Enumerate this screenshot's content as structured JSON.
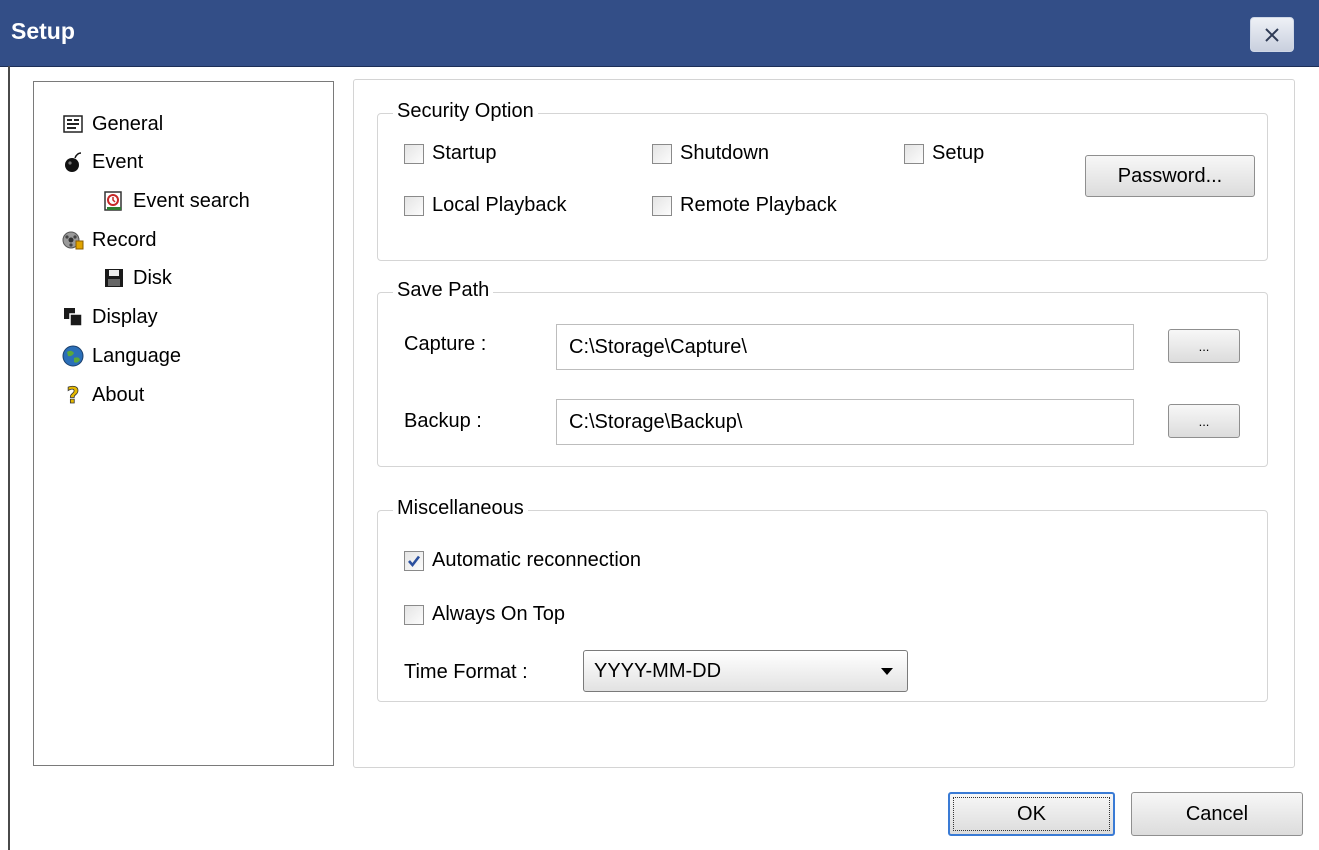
{
  "window": {
    "title": "Setup"
  },
  "nav": {
    "items": [
      {
        "label": "General",
        "icon": "general-icon"
      },
      {
        "label": "Event",
        "icon": "bomb-icon"
      },
      {
        "label": "Event search",
        "icon": "event-search-icon"
      },
      {
        "label": "Record",
        "icon": "record-icon"
      },
      {
        "label": "Disk",
        "icon": "floppy-disk-icon"
      },
      {
        "label": "Display",
        "icon": "display-icon"
      },
      {
        "label": "Language",
        "icon": "globe-icon"
      },
      {
        "label": "About",
        "icon": "question-mark-icon"
      }
    ]
  },
  "security": {
    "legend": "Security Option",
    "startup": "Startup",
    "shutdown": "Shutdown",
    "setup": "Setup",
    "local_playback": "Local Playback",
    "remote_playback": "Remote Playback",
    "password_button": "Password...",
    "checked": {
      "startup": false,
      "shutdown": false,
      "setup": false,
      "local_playback": false,
      "remote_playback": false
    }
  },
  "save_path": {
    "legend": "Save Path",
    "capture_label": "Capture :",
    "capture_value": "C:\\Storage\\Capture\\",
    "backup_label": "Backup :",
    "backup_value": "C:\\Storage\\Backup\\",
    "browse_label": "..."
  },
  "misc": {
    "legend": "Miscellaneous",
    "auto_reconnect": "Automatic reconnection",
    "always_on_top": "Always On Top",
    "time_format_label": "Time Format :",
    "time_format_value": "YYYY-MM-DD",
    "checked": {
      "auto_reconnect": true,
      "always_on_top": false
    }
  },
  "footer": {
    "ok": "OK",
    "cancel": "Cancel"
  },
  "colors": {
    "titlebar": "#334e87",
    "check_blue": "#2a4f9e"
  }
}
